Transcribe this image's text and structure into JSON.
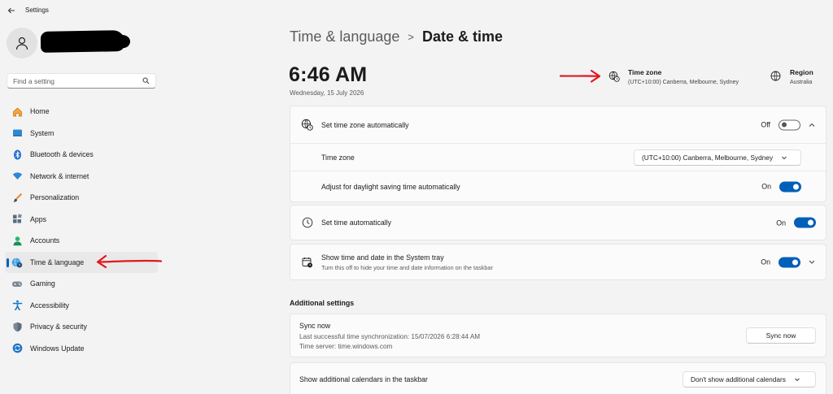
{
  "window": {
    "title": "Settings"
  },
  "search": {
    "placeholder": "Find a setting"
  },
  "nav": [
    {
      "label": "Home",
      "icon": "home-icon"
    },
    {
      "label": "System",
      "icon": "system-icon"
    },
    {
      "label": "Bluetooth & devices",
      "icon": "bluetooth-icon"
    },
    {
      "label": "Network & internet",
      "icon": "wifi-icon"
    },
    {
      "label": "Personalization",
      "icon": "brush-icon"
    },
    {
      "label": "Apps",
      "icon": "apps-icon"
    },
    {
      "label": "Accounts",
      "icon": "account-icon"
    },
    {
      "label": "Time & language",
      "icon": "globe-clock-icon",
      "selected": true
    },
    {
      "label": "Gaming",
      "icon": "gamepad-icon"
    },
    {
      "label": "Accessibility",
      "icon": "accessibility-icon"
    },
    {
      "label": "Privacy & security",
      "icon": "shield-icon"
    },
    {
      "label": "Windows Update",
      "icon": "update-icon"
    }
  ],
  "breadcrumb": {
    "parent": "Time & language",
    "separator": ">",
    "current": "Date & time"
  },
  "clock": {
    "time": "6:46 AM",
    "date": "Wednesday, 15 July 2026"
  },
  "summary": {
    "timezone": {
      "title": "Time zone",
      "value": "(UTC+10:00) Canberra, Melbourne, Sydney"
    },
    "region": {
      "title": "Region",
      "value": "Australia"
    }
  },
  "settings": {
    "auto_timezone": {
      "label": "Set time zone automatically",
      "state": "Off"
    },
    "timezone": {
      "label": "Time zone",
      "value": "(UTC+10:00) Canberra, Melbourne, Sydney"
    },
    "daylight": {
      "label": "Adjust for daylight saving time automatically",
      "state": "On"
    },
    "auto_time": {
      "label": "Set time automatically",
      "state": "On"
    },
    "tray": {
      "label": "Show time and date in the System tray",
      "sub": "Turn this off to hide your time and date information on the taskbar",
      "state": "On"
    }
  },
  "additional": {
    "title": "Additional settings",
    "sync": {
      "label": "Sync now",
      "last_sync": "Last successful time synchronization: 15/07/2026 6:28:44 AM",
      "server": "Time server: time.windows.com",
      "button": "Sync now"
    },
    "calendars": {
      "label": "Show additional calendars in the taskbar",
      "value": "Don't show additional calendars"
    }
  },
  "colors": {
    "accent": "#005fb8",
    "annotation": "#e0191f",
    "background": "#f3f3f3",
    "card": "#fbfbfb"
  }
}
